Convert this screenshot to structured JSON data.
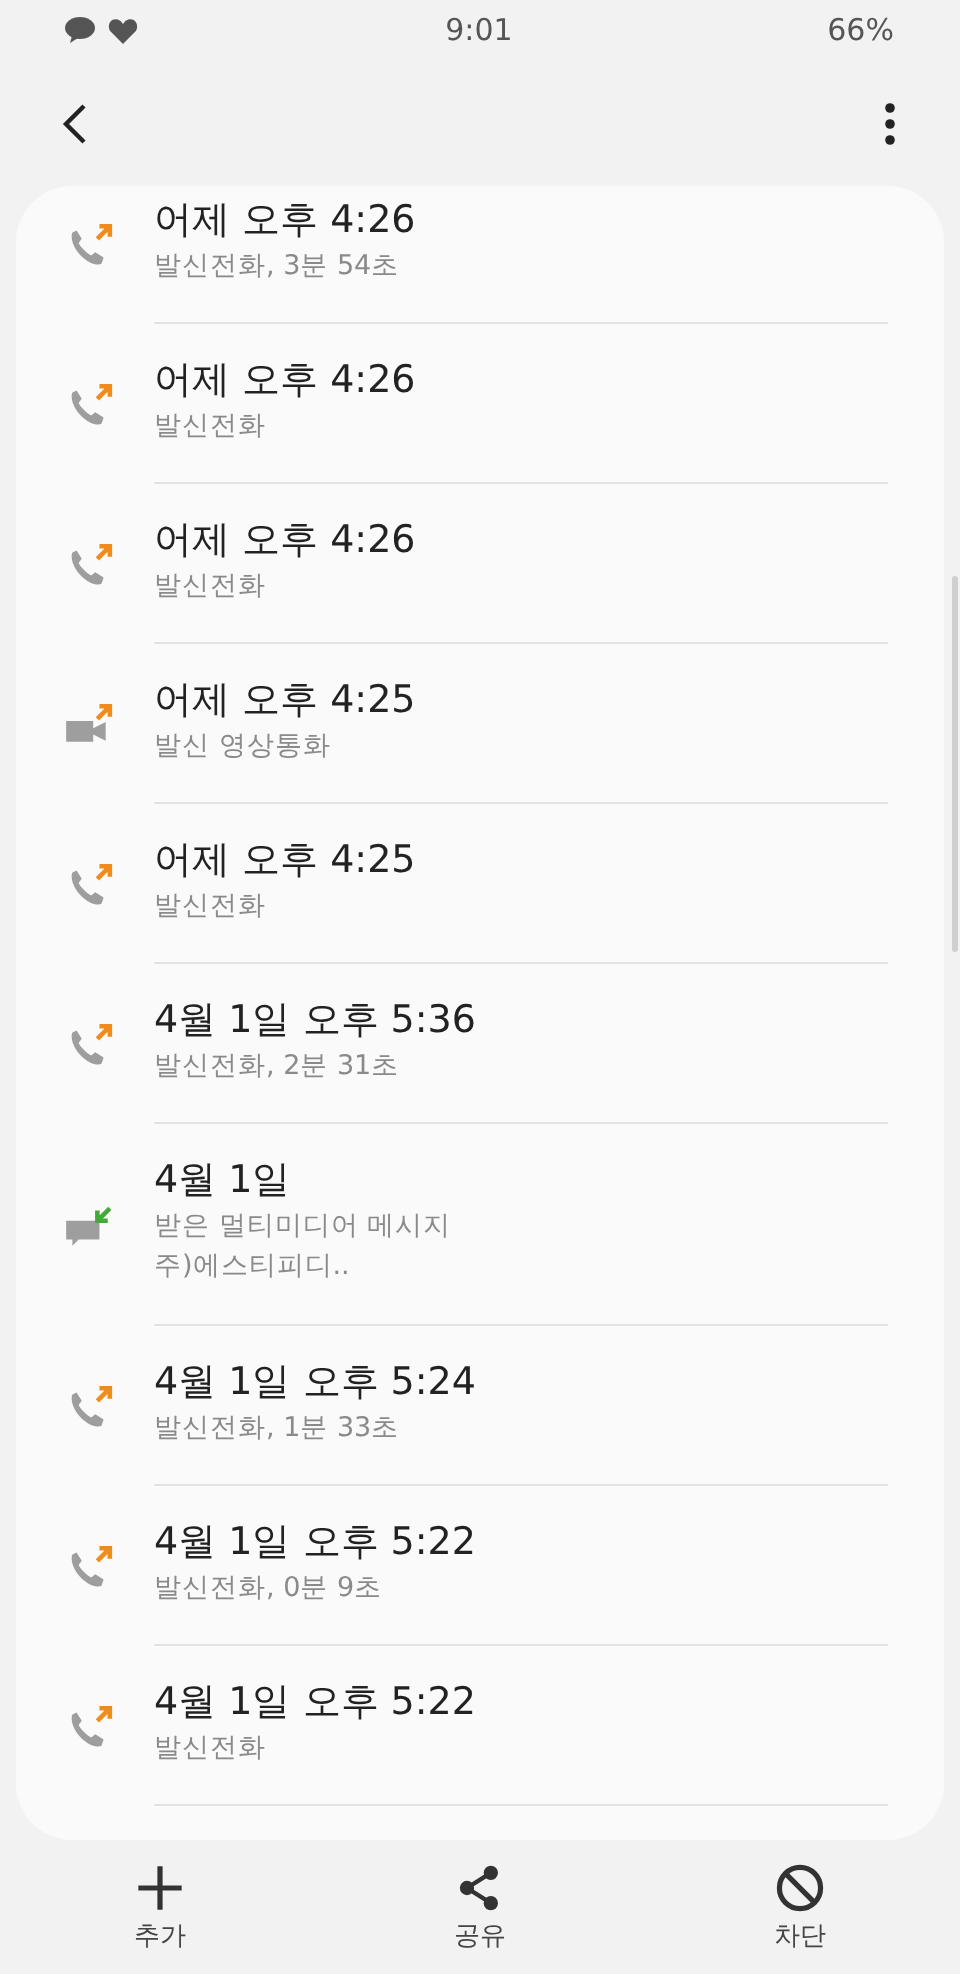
{
  "status_bar": {
    "time": "9:01",
    "battery": "66%"
  },
  "calls": [
    {
      "kind": "call",
      "incoming": false,
      "title": "어제 오후 4:26",
      "lines": [
        "발신전화, 3분 54초"
      ]
    },
    {
      "kind": "call",
      "incoming": false,
      "title": "어제 오후 4:26",
      "lines": [
        "발신전화"
      ]
    },
    {
      "kind": "call",
      "incoming": false,
      "title": "어제 오후 4:26",
      "lines": [
        "발신전화"
      ]
    },
    {
      "kind": "video",
      "incoming": false,
      "title": "어제 오후 4:25",
      "lines": [
        "발신 영상통화"
      ]
    },
    {
      "kind": "call",
      "incoming": false,
      "title": "어제 오후 4:25",
      "lines": [
        "발신전화"
      ]
    },
    {
      "kind": "call",
      "incoming": false,
      "title": "4월 1일 오후 5:36",
      "lines": [
        "발신전화, 2분 31초"
      ]
    },
    {
      "kind": "message",
      "incoming": true,
      "title": "4월 1일",
      "lines": [
        "받은 멀티미디어 메시지",
        "주)에스티피디.."
      ]
    },
    {
      "kind": "call",
      "incoming": false,
      "title": "4월 1일 오후 5:24",
      "lines": [
        "발신전화, 1분 33초"
      ]
    },
    {
      "kind": "call",
      "incoming": false,
      "title": "4월 1일 오후 5:22",
      "lines": [
        "발신전화, 0분 9초"
      ]
    },
    {
      "kind": "call",
      "incoming": false,
      "title": "4월 1일 오후 5:22",
      "lines": [
        "발신전화"
      ]
    }
  ],
  "bottom_bar": [
    {
      "kind": "add",
      "label": "추가"
    },
    {
      "kind": "share",
      "label": "공유"
    },
    {
      "kind": "block",
      "label": "차단"
    }
  ]
}
